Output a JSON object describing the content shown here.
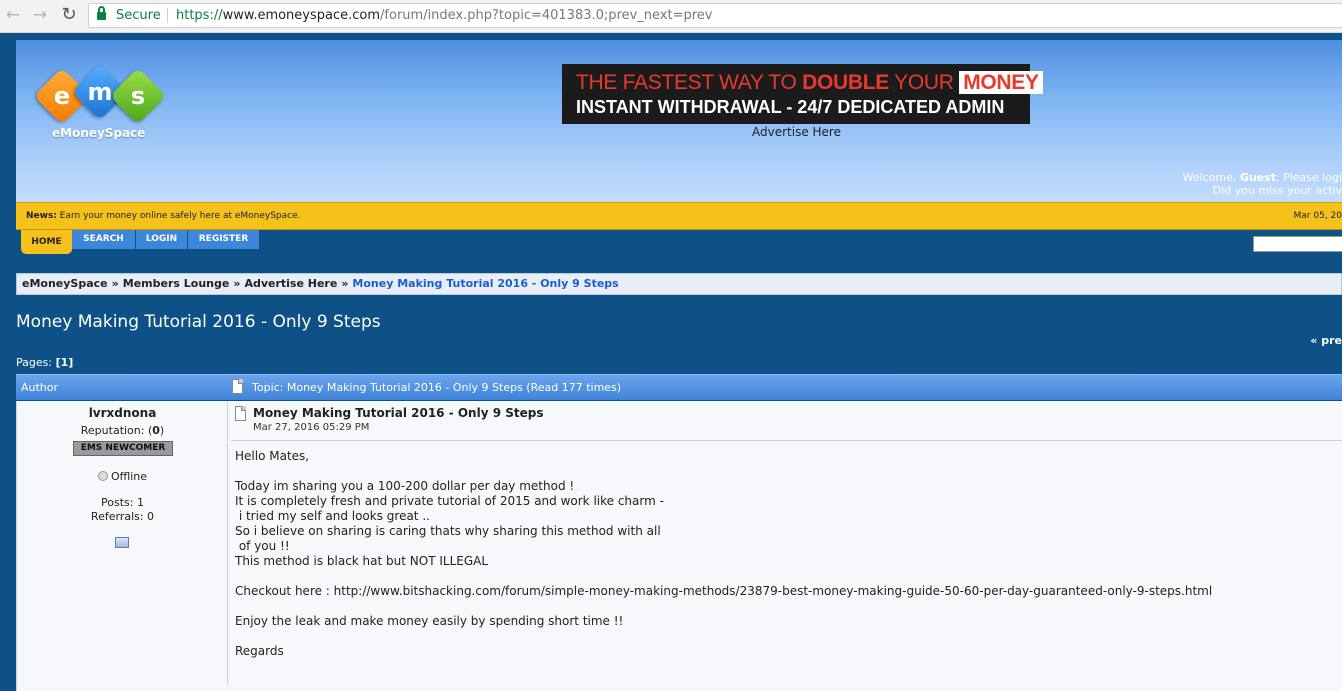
{
  "browser": {
    "secure_label": "Secure",
    "url_scheme": "https://",
    "url_host": "www.emoneyspace.com",
    "url_path": "/forum/index.php?topic=401383.0;prev_next=prev"
  },
  "header": {
    "logo_text": "eMoneySpace",
    "logo_letters": [
      "e",
      "m",
      "s"
    ],
    "banner_line1_a": "THE FASTEST WAY TO ",
    "banner_line1_b": "DOUBLE",
    "banner_line1_c": " YOUR ",
    "banner_line1_d": "MONEY",
    "banner_line2": "INSTANT WITHDRAWAL - 24/7 DEDICATED ADMIN",
    "advertise": "Advertise Here",
    "welcome_prefix": "Welcome, ",
    "welcome_user": "Guest",
    "welcome_mid": ". Please ",
    "welcome_login": "logi",
    "welcome_line2": "Did you miss your activ"
  },
  "news": {
    "label": "News:",
    "text": " Earn your money online safely here at eMoneySpace.",
    "date": "Mar 05, 20"
  },
  "menu": {
    "home": "HOME",
    "search": "SEARCH",
    "login": "LOGIN",
    "register": "REGISTER"
  },
  "breadcrumb": {
    "items": [
      "eMoneySpace",
      "Members Lounge",
      "Advertise Here"
    ],
    "current": "Money Making Tutorial 2016 - Only 9 Steps",
    "separator": "»"
  },
  "topic": {
    "title": "Money Making Tutorial 2016 - Only 9 Steps",
    "prev_link": "« pre",
    "pages_label": "Pages: ",
    "page_current": "[1]",
    "author_header": "Author",
    "topic_header": "Topic: Money Making Tutorial 2016 - Only 9 Steps  (Read 177 times)"
  },
  "poster": {
    "name": "lvrxdnona",
    "reputation_label": "Reputation: (",
    "reputation_value": "0",
    "reputation_end": ")",
    "rank": "EMS NEWCOMER",
    "status": "Offline",
    "posts": "Posts: 1",
    "referrals": "Referrals: 0"
  },
  "post": {
    "title": "Money Making Tutorial 2016 - Only 9 Steps",
    "date": "Mar 27, 2016 05:29 PM",
    "body": "Hello Mates,\n\nToday im sharing you a 100-200 dollar per day method !\nIt is completely fresh and private tutorial of 2015 and work like charm -\n i tried my self and looks great ..\nSo i believe on sharing is caring thats why sharing this method with all\n of you !!\nThis method is black hat but NOT ILLEGAL\n\nCheckout here : http://www.bitshacking.com/forum/simple-money-making-methods/23879-best-money-making-guide-50-60-per-day-guaranteed-only-9-steps.html\n\nEnjoy the leak and make money easily by spending short time !!\n\nRegards"
  },
  "colors": {
    "accent": "#3d87d8",
    "newsbar": "#f5c21b",
    "page_bg": "#0e5186",
    "breadcrumb_current": "#1d5bd6"
  }
}
